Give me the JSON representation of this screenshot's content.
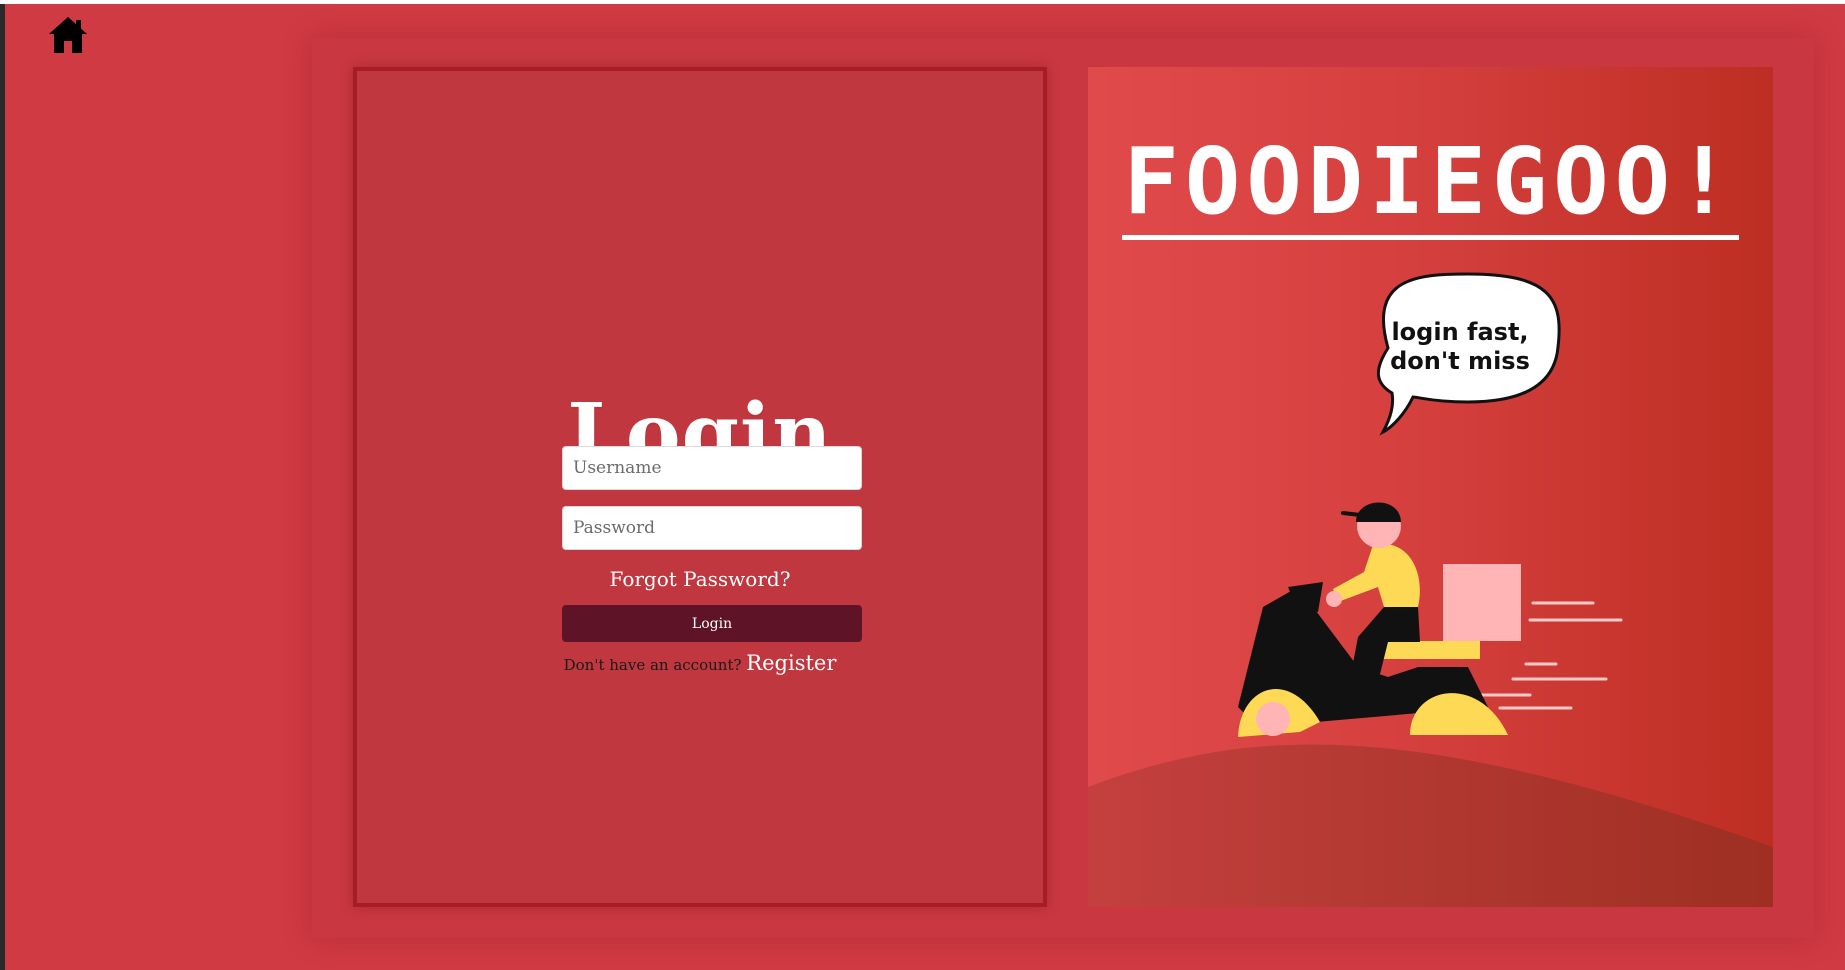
{
  "nav": {
    "home_icon": "home-icon"
  },
  "login": {
    "title": "Login",
    "username_placeholder": "Username",
    "password_placeholder": "Password",
    "forgot_label": "Forgot Password?",
    "submit_label": "Login",
    "no_account_text": "Don't have an account?",
    "register_label": "Register"
  },
  "promo": {
    "brand": "FOODIEGOO!",
    "bubble_line1": "login fast,",
    "bubble_line2": "don't miss"
  },
  "colors": {
    "background": "#cf3a43",
    "login_panel": "#c0373f",
    "login_button": "#5e1426",
    "promo_gradient_start": "#e14a4b",
    "promo_gradient_end": "#bd2e22",
    "rider_yellow": "#fdd956",
    "box_pink": "#ffb5b5"
  }
}
